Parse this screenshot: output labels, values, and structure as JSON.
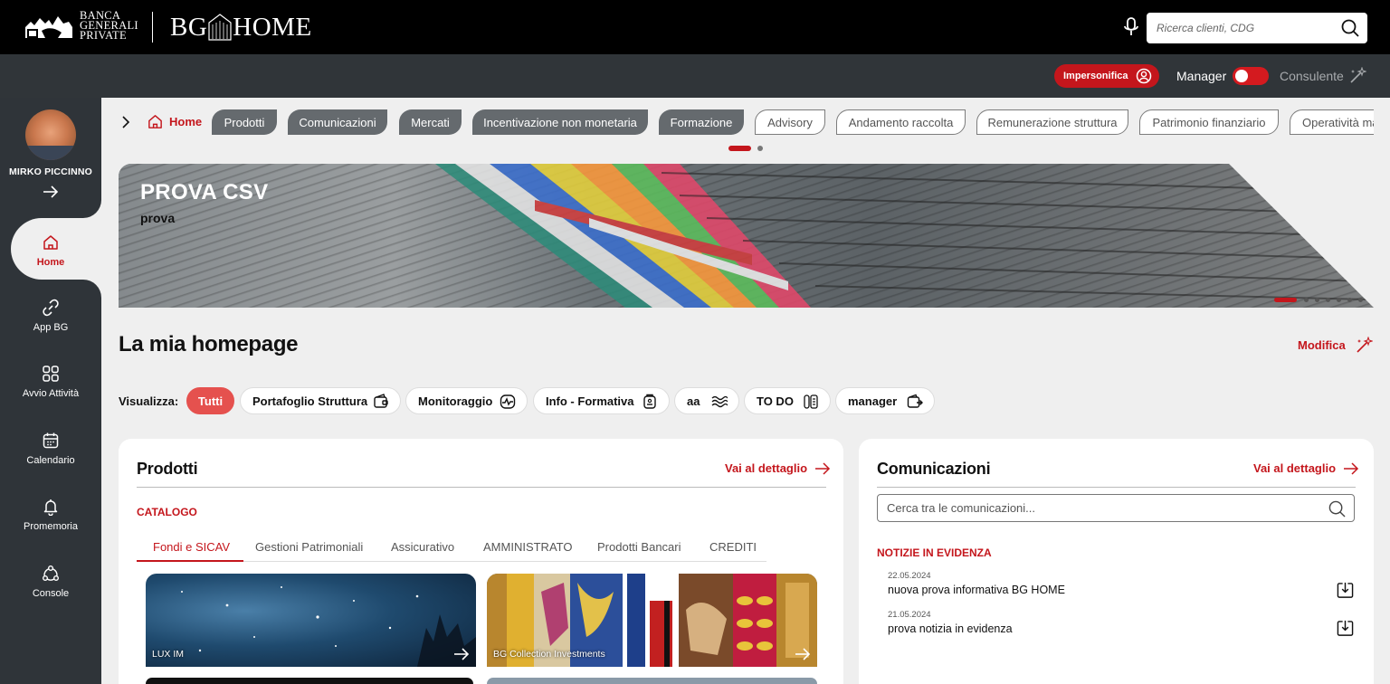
{
  "topbar": {
    "bank_line1": "BANCA",
    "bank_line2": "GENERALI",
    "bank_line3": "PRIVATE",
    "product_left": "BG",
    "product_right": "HOME",
    "search_placeholder": "Ricerca clienti, CDG"
  },
  "subbar": {
    "impersonifica_label": "Impersonifica",
    "manager_label": "Manager",
    "consulente_label": "Consulente",
    "toggle_on": true
  },
  "sidebar": {
    "user_name": "MIRKO PICCINNO",
    "items": [
      {
        "label": "Home",
        "icon": "home-icon",
        "active": true
      },
      {
        "label": "App BG",
        "icon": "link-icon"
      },
      {
        "label": "Avvio Attività",
        "icon": "grid-icon"
      },
      {
        "label": "Calendario",
        "icon": "calendar-icon"
      },
      {
        "label": "Promemoria",
        "icon": "bell-icon"
      },
      {
        "label": "Console",
        "icon": "network-icon"
      }
    ]
  },
  "tabs": {
    "home_label": "Home",
    "categories": [
      {
        "label": "Prodotti",
        "style": "dark"
      },
      {
        "label": "Comunicazioni",
        "style": "dark"
      },
      {
        "label": "Mercati",
        "style": "dark"
      },
      {
        "label": "Incentivazione non monetaria",
        "style": "dark"
      },
      {
        "label": "Formazione",
        "style": "dark"
      },
      {
        "label": "Advisory",
        "style": "light"
      },
      {
        "label": "Andamento raccolta",
        "style": "light"
      },
      {
        "label": "Remunerazione struttura",
        "style": "light"
      },
      {
        "label": "Patrimonio finanziario",
        "style": "light"
      },
      {
        "label": "Operatività ma",
        "style": "light"
      }
    ],
    "pager_pages": 2,
    "pager_active": 1
  },
  "banner": {
    "title": "PROVA CSV",
    "subtitle": "prova",
    "pager_pages": 7,
    "pager_active": 1
  },
  "homepage": {
    "title": "La mia homepage",
    "edit_label": "Modifica",
    "filter_label": "Visualizza:",
    "filters": [
      {
        "label": "Tutti",
        "active": true
      },
      {
        "label": "Portafoglio Struttura",
        "icon": "wallet-icon"
      },
      {
        "label": "Monitoraggio",
        "icon": "pulse-icon"
      },
      {
        "label": "Info - Formativa",
        "icon": "badge-icon"
      },
      {
        "label": "aa",
        "icon": "waves-icon"
      },
      {
        "label": "TO DO",
        "icon": "checklist-icon"
      },
      {
        "label": "manager",
        "icon": "wallet-arrow-icon"
      }
    ]
  },
  "prodotti": {
    "title": "Prodotti",
    "detail_link": "Vai al dettaglio",
    "section": "CATALOGO",
    "tabs": [
      "Fondi e SICAV",
      "Gestioni Patrimoniali",
      "Assicurativo",
      "AMMINISTRATO",
      "Prodotti Bancari",
      "CREDITI"
    ],
    "active_tab": 0,
    "tiles": [
      {
        "label": "LUX IM"
      },
      {
        "label": "BG Collection Investments"
      }
    ]
  },
  "comunicazioni": {
    "title": "Comunicazioni",
    "detail_link": "Vai al dettaglio",
    "search_placeholder": "Cerca tra le comunicazioni...",
    "section": "NOTIZIE IN EVIDENZA",
    "news": [
      {
        "date": "22.05.2024",
        "title": "nuova prova informativa BG HOME"
      },
      {
        "date": "21.05.2024",
        "title": "prova notizia in evidenza"
      }
    ]
  },
  "colors": {
    "brand_red": "#c4161c",
    "chip_active": "#e5514e",
    "topbar": "#000000",
    "subbar": "#303539"
  }
}
